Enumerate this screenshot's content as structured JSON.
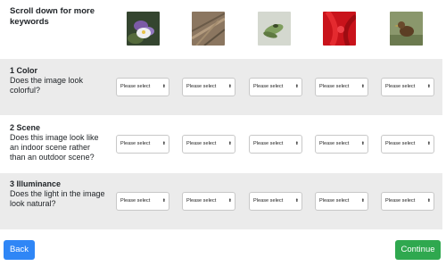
{
  "header": {
    "scroll_hint": "Scroll down for more keywords"
  },
  "images": [
    {
      "name": "purple-flower-image",
      "palette": [
        "#3a4a33",
        "#8a6bb0",
        "#e9e4ef"
      ]
    },
    {
      "name": "grass-plants-image",
      "palette": [
        "#6b5a48",
        "#8e7a63",
        "#b79f84"
      ]
    },
    {
      "name": "insect-on-leaves-image",
      "palette": [
        "#d7dad0",
        "#7c9a5c",
        "#3b4b2a"
      ]
    },
    {
      "name": "red-flower-image",
      "palette": [
        "#c4121a",
        "#e01820",
        "#7a0a0d"
      ]
    },
    {
      "name": "bird-in-grass-image",
      "palette": [
        "#8c9a6d",
        "#6a7850",
        "#5a3d22"
      ]
    }
  ],
  "select_placeholder": "Please select",
  "questions": [
    {
      "title": "1 Color",
      "text": "Does the image look colorful?"
    },
    {
      "title": "2 Scene",
      "text": "Does this image look like an indoor scene rather than an outdoor scene?"
    },
    {
      "title": "3 Illuminance",
      "text": "Does the light in the image look natural?"
    }
  ],
  "buttons": {
    "back": "Back",
    "continue": "Continue"
  },
  "colors": {
    "back": "#2f86f6",
    "continue": "#2fa84f",
    "shaded_row": "#ebebeb"
  }
}
